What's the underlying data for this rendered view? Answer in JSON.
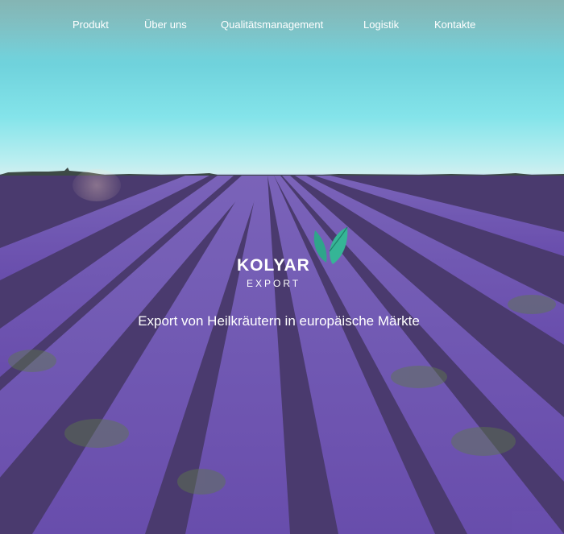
{
  "nav": {
    "items": [
      {
        "label": "Produkt"
      },
      {
        "label": "Über uns"
      },
      {
        "label": "Qualitätsmanagement"
      },
      {
        "label": "Logistik"
      },
      {
        "label": "Kontakte"
      }
    ]
  },
  "hero": {
    "logo_name": "KOLYAR",
    "logo_sub": "EXPORT",
    "logo_icon": "leaf-icon",
    "tagline": "Export von Heilkräutern in europäische Märkte"
  },
  "colors": {
    "accent": "#2fa58a",
    "text": "#ffffff",
    "sky": "#84e4ea",
    "lavender": "#6f55ab"
  }
}
